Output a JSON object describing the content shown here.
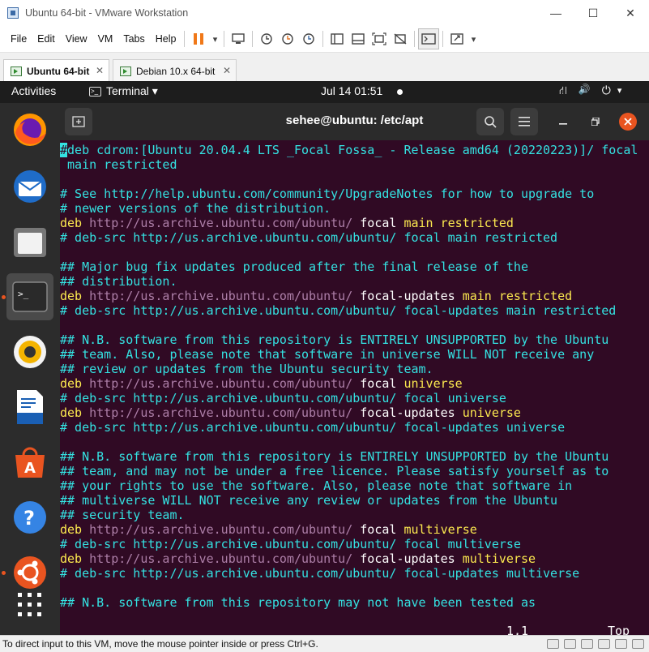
{
  "window": {
    "title": "Ubuntu 64-bit - VMware Workstation",
    "minimize": "—",
    "maximize": "☐",
    "close": "✕"
  },
  "menu": {
    "items": [
      "File",
      "Edit",
      "View",
      "VM",
      "Tabs",
      "Help"
    ],
    "dropdown_arrow": "▾"
  },
  "vm_tabs": [
    {
      "label": "Ubuntu 64-bit",
      "close": "✕"
    },
    {
      "label": "Debian 10.x 64-bit",
      "close": "✕"
    }
  ],
  "gnome": {
    "activities": "Activities",
    "app_menu": "Terminal ▾",
    "clock": "Jul 14  01:51",
    "network_icon": "⛙",
    "volume_icon": "🔊",
    "power_icon": "⏻",
    "arrow": "▾"
  },
  "terminal": {
    "title": "sehee@ubuntu: /etc/apt",
    "lines": [
      [
        {
          "t": "#",
          "c": "cur"
        },
        {
          "t": "deb cdrom:[Ubuntu 20.04.4 LTS _Focal Fossa_ - Release amd64 (20220223)]/ focal"
        }
      ],
      [
        {
          "t": " main restricted"
        }
      ],
      [],
      [
        {
          "t": "# See http://help.ubuntu.com/community/UpgradeNotes for how to upgrade to"
        }
      ],
      [
        {
          "t": "# newer versions of the distribution."
        }
      ],
      [
        {
          "t": "deb",
          "c": "k"
        },
        {
          "t": " "
        },
        {
          "t": "http://us.archive.ubuntu.com/ubuntu/",
          "c": "u"
        },
        {
          "t": " "
        },
        {
          "t": "focal",
          "c": "g"
        },
        {
          "t": " "
        },
        {
          "t": "main restricted",
          "c": "k"
        }
      ],
      [
        {
          "t": "# deb-src http://us.archive.ubuntu.com/ubuntu/ focal main restricted"
        }
      ],
      [],
      [
        {
          "t": "## Major bug fix updates produced after the final release of the"
        }
      ],
      [
        {
          "t": "## distribution."
        }
      ],
      [
        {
          "t": "deb",
          "c": "k"
        },
        {
          "t": " "
        },
        {
          "t": "http://us.archive.ubuntu.com/ubuntu/",
          "c": "u"
        },
        {
          "t": " "
        },
        {
          "t": "focal-updates",
          "c": "g"
        },
        {
          "t": " "
        },
        {
          "t": "main restricted",
          "c": "k"
        }
      ],
      [
        {
          "t": "# deb-src http://us.archive.ubuntu.com/ubuntu/ focal-updates main restricted"
        }
      ],
      [],
      [
        {
          "t": "## N.B. software from this repository is ENTIRELY UNSUPPORTED by the Ubuntu"
        }
      ],
      [
        {
          "t": "## team. Also, please note that software in universe WILL NOT receive any"
        }
      ],
      [
        {
          "t": "## review or updates from the Ubuntu security team."
        }
      ],
      [
        {
          "t": "deb",
          "c": "k"
        },
        {
          "t": " "
        },
        {
          "t": "http://us.archive.ubuntu.com/ubuntu/",
          "c": "u"
        },
        {
          "t": " "
        },
        {
          "t": "focal",
          "c": "g"
        },
        {
          "t": " "
        },
        {
          "t": "universe",
          "c": "k"
        }
      ],
      [
        {
          "t": "# deb-src http://us.archive.ubuntu.com/ubuntu/ focal universe"
        }
      ],
      [
        {
          "t": "deb",
          "c": "k"
        },
        {
          "t": " "
        },
        {
          "t": "http://us.archive.ubuntu.com/ubuntu/",
          "c": "u"
        },
        {
          "t": " "
        },
        {
          "t": "focal-updates",
          "c": "g"
        },
        {
          "t": " "
        },
        {
          "t": "universe",
          "c": "k"
        }
      ],
      [
        {
          "t": "# deb-src http://us.archive.ubuntu.com/ubuntu/ focal-updates universe"
        }
      ],
      [],
      [
        {
          "t": "## N.B. software from this repository is ENTIRELY UNSUPPORTED by the Ubuntu"
        }
      ],
      [
        {
          "t": "## team, and may not be under a free licence. Please satisfy yourself as to"
        }
      ],
      [
        {
          "t": "## your rights to use the software. Also, please note that software in"
        }
      ],
      [
        {
          "t": "## multiverse WILL NOT receive any review or updates from the Ubuntu"
        }
      ],
      [
        {
          "t": "## security team."
        }
      ],
      [
        {
          "t": "deb",
          "c": "k"
        },
        {
          "t": " "
        },
        {
          "t": "http://us.archive.ubuntu.com/ubuntu/",
          "c": "u"
        },
        {
          "t": " "
        },
        {
          "t": "focal",
          "c": "g"
        },
        {
          "t": " "
        },
        {
          "t": "multiverse",
          "c": "k"
        }
      ],
      [
        {
          "t": "# deb-src http://us.archive.ubuntu.com/ubuntu/ focal multiverse"
        }
      ],
      [
        {
          "t": "deb",
          "c": "k"
        },
        {
          "t": " "
        },
        {
          "t": "http://us.archive.ubuntu.com/ubuntu/",
          "c": "u"
        },
        {
          "t": " "
        },
        {
          "t": "focal-updates",
          "c": "g"
        },
        {
          "t": " "
        },
        {
          "t": "multiverse",
          "c": "k"
        }
      ],
      [
        {
          "t": "# deb-src http://us.archive.ubuntu.com/ubuntu/ focal-updates multiverse"
        }
      ],
      [],
      [
        {
          "t": "## N.B. software from this repository may not have been tested as"
        }
      ]
    ],
    "cursor_pos": "1,1",
    "scroll_pos": "Top"
  },
  "status": {
    "message": "To direct input to this VM, move the mouse pointer inside or press Ctrl+G."
  },
  "colors": {
    "terminal_bg": "#300a24",
    "comment": "#34e2e2",
    "keyword": "#fce94f",
    "url": "#ad7fa8",
    "accent": "#e95420"
  },
  "dock_icons": [
    "firefox-icon",
    "thunderbird-icon",
    "files-icon",
    "terminal-icon",
    "rhythmbox-icon",
    "writer-icon",
    "software-icon",
    "help-icon",
    "ubuntu-icon",
    "show-apps-icon"
  ]
}
